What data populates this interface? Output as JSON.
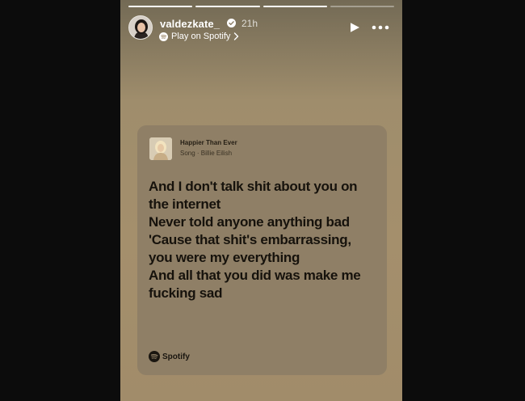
{
  "story": {
    "progress": {
      "total_segments": 4,
      "completed_segments": 3
    },
    "user": {
      "username": "valdezkate_",
      "verified": true,
      "time_ago": "21h",
      "play_on_label": "Play on Spotify"
    },
    "icons": {
      "play": "play-icon",
      "more": "more-horizontal-icon",
      "verified": "verified-badge-icon",
      "spotify": "spotify-icon",
      "chevron": "chevron-right-icon"
    }
  },
  "card": {
    "song_title": "Happier Than Ever",
    "song_meta": "Song · Billie Eilish",
    "lyrics": [
      "And I don't talk shit about you on",
      "the internet",
      "Never told anyone anything bad",
      "'Cause that shit's embarrassing,",
      "you were my everything",
      "And all that you did was make me",
      "fucking sad"
    ],
    "brand_label": "Spotify"
  },
  "colors": {
    "page_bg": "#0c0c0c",
    "story_bg": "#a48f6c",
    "card_bg": "#8f7f66",
    "lyrics_text": "#16120c"
  }
}
